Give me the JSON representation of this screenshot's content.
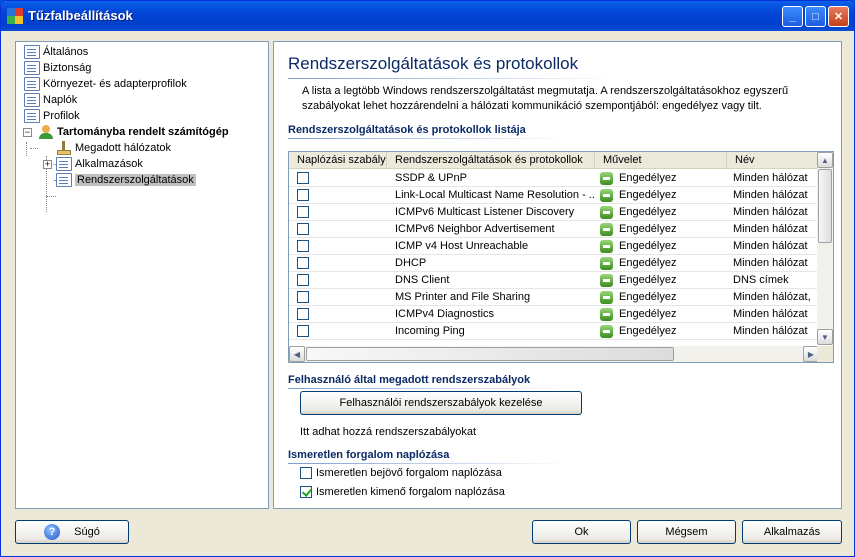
{
  "window": {
    "title": "Tűzfalbeállítások",
    "minimize": "_",
    "maximize": "□",
    "close": "✕"
  },
  "tree": {
    "items": [
      {
        "label": "Általános"
      },
      {
        "label": "Biztonság"
      },
      {
        "label": "Környezet- és adapterprofilok"
      },
      {
        "label": "Naplók"
      },
      {
        "label": "Profilok"
      },
      {
        "label": "Tartományba rendelt számítógép"
      },
      {
        "label": "Megadott hálózatok"
      },
      {
        "label": "Alkalmazások"
      },
      {
        "label": "Rendszerszolgáltatások"
      }
    ],
    "collapse_glyph": "−",
    "expand_glyph": "+"
  },
  "panel": {
    "title": "Rendszerszolgáltatások és protokollok",
    "description": "A lista a legtöbb Windows rendszerszolgáltatást megmutatja. A rendszerszolgáltatásokhoz egyszerű szabályokat lehet hozzárendelni a hálózati kommunikáció szempontjából: engedélyez vagy tilt.",
    "list_section": "Rendszerszolgáltatások és protokollok listája",
    "columns": [
      "Naplózási szabály",
      "Rendszerszolgáltatások és protokollok",
      "Művelet",
      "Név"
    ],
    "rows": [
      {
        "name": "SSDP & UPnP",
        "action": "Engedélyez",
        "scope": "Minden hálózat"
      },
      {
        "name": "Link-Local Multicast Name Resolution - ...",
        "action": "Engedélyez",
        "scope": "Minden hálózat"
      },
      {
        "name": "ICMPv6 Multicast Listener Discovery",
        "action": "Engedélyez",
        "scope": "Minden hálózat"
      },
      {
        "name": "ICMPv6 Neighbor Advertisement",
        "action": "Engedélyez",
        "scope": "Minden hálózat"
      },
      {
        "name": "ICMP v4 Host Unreachable",
        "action": "Engedélyez",
        "scope": "Minden hálózat"
      },
      {
        "name": "DHCP",
        "action": "Engedélyez",
        "scope": "Minden hálózat"
      },
      {
        "name": "DNS Client",
        "action": "Engedélyez",
        "scope": "DNS címek"
      },
      {
        "name": "MS Printer and File Sharing",
        "action": "Engedélyez",
        "scope": "Minden hálózat,"
      },
      {
        "name": "ICMPv4 Diagnostics",
        "action": "Engedélyez",
        "scope": "Minden hálózat"
      },
      {
        "name": "Incoming Ping",
        "action": "Engedélyez",
        "scope": "Minden hálózat"
      }
    ],
    "user_section": "Felhasználó által megadott rendszerszabályok",
    "user_button": "Felhasználói rendszerszabályok kezelése",
    "user_hint": "Itt adhat hozzá rendszerszabályokat",
    "log_section": "Ismeretlen forgalom naplózása",
    "log_incoming": "Ismeretlen bejövő forgalom naplózása",
    "log_incoming_checked": false,
    "log_outgoing": "Ismeretlen kimenő forgalom naplózása",
    "log_outgoing_checked": true
  },
  "footer": {
    "help": "Súgó",
    "help_icon": "?",
    "ok": "Ok",
    "cancel": "Mégsem",
    "apply": "Alkalmazás"
  },
  "scroll": {
    "up": "▲",
    "down": "▼",
    "left": "◀",
    "right": "▶"
  }
}
